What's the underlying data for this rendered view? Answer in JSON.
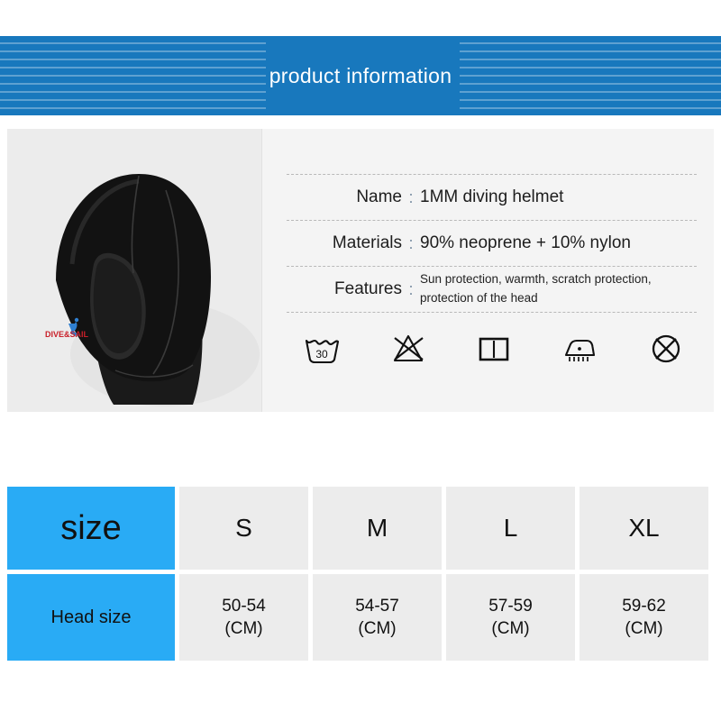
{
  "banner": {
    "title": "product information",
    "bg_color": "#1878bd",
    "stripe_color": "#3a93cc",
    "text_color": "#ffffff"
  },
  "product": {
    "photo_alt": "black neoprene diving hood",
    "logo_text": "DIVE&SAIL"
  },
  "specs": {
    "colon": ":",
    "rows": [
      {
        "label": "Name",
        "value": "1MM diving helmet"
      },
      {
        "label": "Materials",
        "value": "90% neoprene + 10% nylon"
      }
    ],
    "features": {
      "label": "Features",
      "line1": "Sun protection, warmth, scratch protection,",
      "line2": "protection of the head"
    }
  },
  "care_icons": [
    {
      "name": "wash-30-icon",
      "label": "30"
    },
    {
      "name": "do-not-bleach-icon",
      "label": ""
    },
    {
      "name": "dry-flat-icon",
      "label": ""
    },
    {
      "name": "iron-steam-icon",
      "label": ""
    },
    {
      "name": "do-not-dry-clean-icon",
      "label": ""
    }
  ],
  "size_table": {
    "accent_color": "#29abf5",
    "cell_color": "#ececec",
    "header": {
      "title": "size",
      "sizes": [
        "S",
        "M",
        "L",
        "XL"
      ]
    },
    "head_size": {
      "title": "Head size",
      "values": [
        {
          "range": "50-54",
          "unit": "(CM)"
        },
        {
          "range": "54-57",
          "unit": "(CM)"
        },
        {
          "range": "57-59",
          "unit": "(CM)"
        },
        {
          "range": "59-62",
          "unit": "(CM)"
        }
      ]
    }
  }
}
